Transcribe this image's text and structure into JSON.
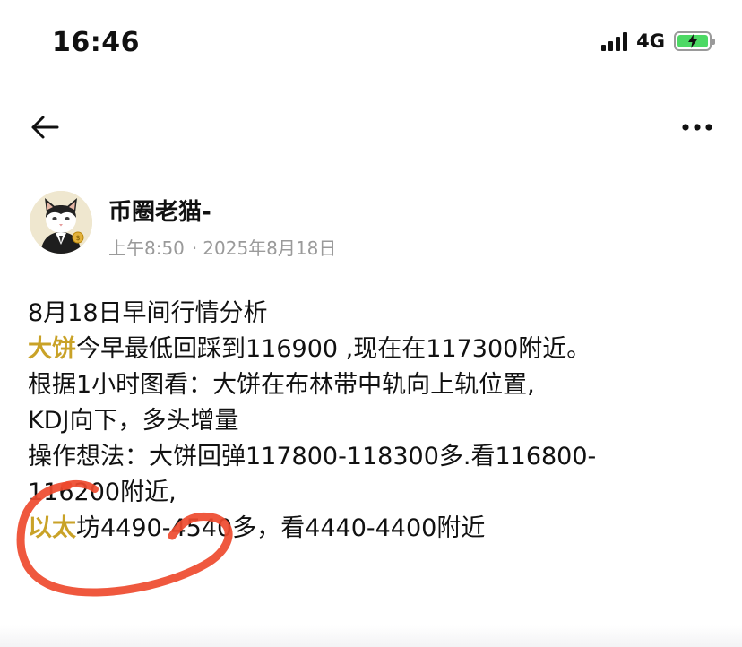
{
  "status_bar": {
    "time": "16:46",
    "network": "4G",
    "battery_color": "#4cd964",
    "signal_icon": "cellular-signal-icon",
    "battery_icon": "battery-charging-icon"
  },
  "nav": {
    "back_icon": "arrow-left-icon",
    "more_icon": "more-horizontal-icon"
  },
  "author": {
    "name": "币圈老猫-",
    "time": "上午8:50",
    "separator": "·",
    "date": "2025年8月18日",
    "avatar_icon": "cat-in-suit-avatar"
  },
  "post": {
    "line1": "8月18日早间行情分析",
    "line2_coin": "大饼",
    "line2_rest": "今早最低回踩到116900 ,现在在117300附近。",
    "line3": "根据1小时图看：大饼在布林带中轨向上轨位置,",
    "line4": "KDJ向下，多头增量",
    "line5": "操作想法：大饼回弹117800-118300多.看116800-",
    "line6": "116200附近,",
    "line7_coin": "以太",
    "line7_rest": "坊4490-4540多，看4440-4400附近",
    "coin_color": "#c9a227",
    "annotation_color": "#ee4a2e"
  }
}
